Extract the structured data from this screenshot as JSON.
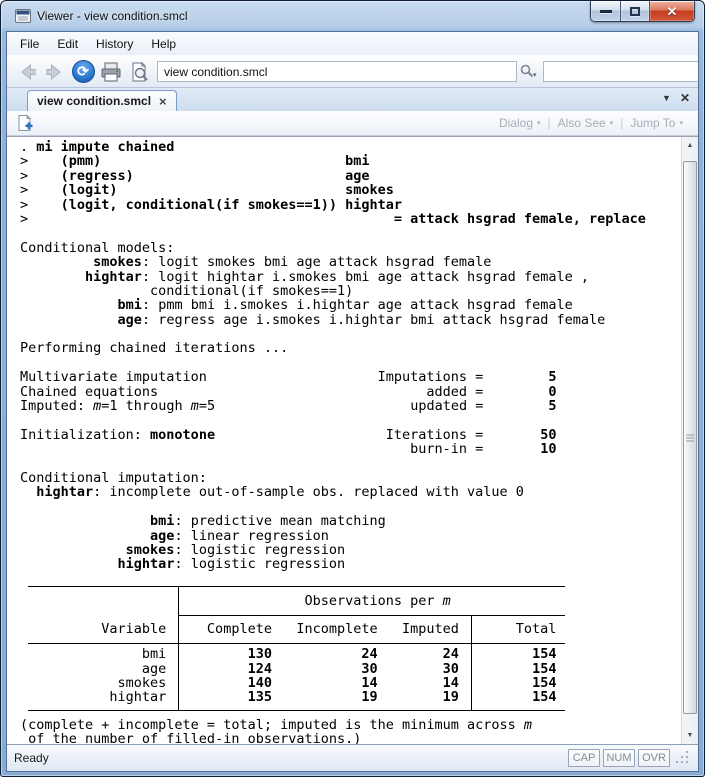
{
  "window": {
    "title": "Viewer - view condition.smcl"
  },
  "menu": {
    "items": [
      "File",
      "Edit",
      "History",
      "Help"
    ]
  },
  "toolbar": {
    "address_value": "view condition.smcl",
    "search_value": ""
  },
  "tabbar": {
    "tab_label": "view condition.smcl"
  },
  "doc_toolbar": {
    "dialog_label": "Dialog",
    "also_see_label": "Also See",
    "jump_to_label": "Jump To"
  },
  "statusbar": {
    "ready": "Ready",
    "cap": "CAP",
    "num": "NUM",
    "ovr": "OVR"
  },
  "icons": {
    "close_x": "×",
    "caret_down": "▾",
    "chevron_down": "▼",
    "arrow_up": "▲",
    "arrow_down": "▼",
    "separator": "|",
    "refresh_glyph": "⟳",
    "close_glyph": "✕"
  },
  "colors": {
    "aero_blue": "#a9c6e4",
    "close_button_red": "#c63d20",
    "refresh_blue": "#2e7cd0",
    "output_text": "#000000",
    "disabled_label": "#a9aeb6"
  },
  "content": {
    "pre_table_lines": [
      [
        [
          "r",
          ". "
        ],
        [
          "b",
          "mi impute chained"
        ]
      ],
      [
        [
          "r",
          ">    "
        ],
        [
          "b",
          "(pmm)"
        ],
        [
          "r",
          "                              "
        ],
        [
          "b",
          "bmi"
        ]
      ],
      [
        [
          "r",
          ">    "
        ],
        [
          "b",
          "(regress)"
        ],
        [
          "r",
          "                          "
        ],
        [
          "b",
          "age"
        ]
      ],
      [
        [
          "r",
          ">    "
        ],
        [
          "b",
          "(logit)"
        ],
        [
          "r",
          "                            "
        ],
        [
          "b",
          "smokes"
        ]
      ],
      [
        [
          "r",
          ">    "
        ],
        [
          "b",
          "(logit, conditional(if smokes==1)) hightar"
        ]
      ],
      [
        [
          "r",
          ">"
        ],
        [
          "r",
          "                                             "
        ],
        [
          "b",
          "= attack hsgrad female, replace"
        ]
      ],
      [],
      [
        [
          "r",
          "Conditional models:"
        ]
      ],
      [
        [
          "r",
          "         "
        ],
        [
          "b",
          "smokes"
        ],
        [
          "r",
          ": logit smokes bmi age attack hsgrad female"
        ]
      ],
      [
        [
          "r",
          "        "
        ],
        [
          "b",
          "hightar"
        ],
        [
          "r",
          ": logit hightar i.smokes bmi age attack hsgrad female ,"
        ]
      ],
      [
        [
          "r",
          "                conditional(if smokes==1)"
        ]
      ],
      [
        [
          "r",
          "            "
        ],
        [
          "b",
          "bmi"
        ],
        [
          "r",
          ": pmm bmi i.smokes i.hightar age attack hsgrad female"
        ]
      ],
      [
        [
          "r",
          "            "
        ],
        [
          "b",
          "age"
        ],
        [
          "r",
          ": regress age i.smokes i.hightar bmi attack hsgrad female"
        ]
      ],
      [],
      [
        [
          "r",
          "Performing chained iterations ..."
        ]
      ],
      [],
      [
        [
          "r",
          "Multivariate imputation"
        ],
        [
          "r",
          "                     "
        ],
        [
          "r",
          "Imputations = "
        ],
        [
          "b",
          "       5"
        ]
      ],
      [
        [
          "r",
          "Chained equations"
        ],
        [
          "r",
          "                                 "
        ],
        [
          "r",
          "added = "
        ],
        [
          "b",
          "       0"
        ]
      ],
      [
        [
          "r",
          "Imputed: "
        ],
        [
          "i",
          "m"
        ],
        [
          "r",
          "=1 through "
        ],
        [
          "i",
          "m"
        ],
        [
          "r",
          "=5"
        ],
        [
          "r",
          "                        "
        ],
        [
          "r",
          "updated = "
        ],
        [
          "b",
          "       5"
        ]
      ],
      [],
      [
        [
          "r",
          "Initialization: "
        ],
        [
          "b",
          "monotone"
        ],
        [
          "r",
          "                     "
        ],
        [
          "r",
          "Iterations = "
        ],
        [
          "b",
          "      50"
        ]
      ],
      [
        [
          "r",
          "                                                "
        ],
        [
          "r",
          "burn-in = "
        ],
        [
          "b",
          "      10"
        ]
      ],
      [],
      [
        [
          "r",
          "Conditional imputation:"
        ]
      ],
      [
        [
          "r",
          "  "
        ],
        [
          "b",
          "hightar"
        ],
        [
          "r",
          ": incomplete out-of-sample obs. replaced with value 0"
        ]
      ],
      [],
      [
        [
          "r",
          "                "
        ],
        [
          "b",
          "bmi"
        ],
        [
          "r",
          ": predictive mean matching"
        ]
      ],
      [
        [
          "r",
          "                "
        ],
        [
          "b",
          "age"
        ],
        [
          "r",
          ": linear regression"
        ]
      ],
      [
        [
          "r",
          "             "
        ],
        [
          "b",
          "smokes"
        ],
        [
          "r",
          ": logistic regression"
        ]
      ],
      [
        [
          "r",
          "            "
        ],
        [
          "b",
          "hightar"
        ],
        [
          "r",
          ": logistic regression"
        ]
      ],
      []
    ],
    "table": {
      "span_header": [
        [
          "r",
          "                                  "
        ],
        [
          "r",
          "Observations per "
        ],
        [
          "i",
          "m"
        ]
      ],
      "column_header": [
        [
          "r",
          "         Variable     Complete   Incomplete   Imputed       Total"
        ]
      ],
      "rows": [
        [
          [
            "r",
            "              bmi"
          ],
          [
            "r",
            "          "
          ],
          [
            "b",
            "130"
          ],
          [
            "r",
            "           "
          ],
          [
            "b",
            "24"
          ],
          [
            "r",
            "        "
          ],
          [
            "b",
            "24"
          ],
          [
            "r",
            "         "
          ],
          [
            "b",
            "154"
          ]
        ],
        [
          [
            "r",
            "              age"
          ],
          [
            "r",
            "          "
          ],
          [
            "b",
            "124"
          ],
          [
            "r",
            "           "
          ],
          [
            "b",
            "30"
          ],
          [
            "r",
            "        "
          ],
          [
            "b",
            "30"
          ],
          [
            "r",
            "         "
          ],
          [
            "b",
            "154"
          ]
        ],
        [
          [
            "r",
            "           smokes"
          ],
          [
            "r",
            "          "
          ],
          [
            "b",
            "140"
          ],
          [
            "r",
            "           "
          ],
          [
            "b",
            "14"
          ],
          [
            "r",
            "        "
          ],
          [
            "b",
            "14"
          ],
          [
            "r",
            "         "
          ],
          [
            "b",
            "154"
          ]
        ],
        [
          [
            "r",
            "          hightar"
          ],
          [
            "r",
            "          "
          ],
          [
            "b",
            "135"
          ],
          [
            "r",
            "           "
          ],
          [
            "b",
            "19"
          ],
          [
            "r",
            "        "
          ],
          [
            "b",
            "19"
          ],
          [
            "r",
            "         "
          ],
          [
            "b",
            "154"
          ]
        ]
      ]
    },
    "post_table_lines": [
      [
        [
          "r",
          "(complete + incomplete = total; imputed is the minimum across "
        ],
        [
          "i",
          "m"
        ]
      ],
      [
        [
          "r",
          " of the number of filled-in observations.)"
        ]
      ]
    ]
  }
}
